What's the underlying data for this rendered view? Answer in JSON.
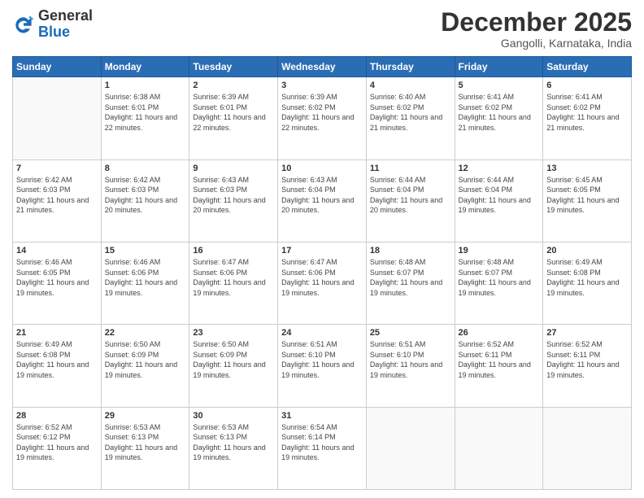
{
  "header": {
    "logo_general": "General",
    "logo_blue": "Blue",
    "month_title": "December 2025",
    "location": "Gangolli, Karnataka, India"
  },
  "weekdays": [
    "Sunday",
    "Monday",
    "Tuesday",
    "Wednesday",
    "Thursday",
    "Friday",
    "Saturday"
  ],
  "weeks": [
    [
      {
        "num": "",
        "sunrise": "",
        "sunset": "",
        "daylight": ""
      },
      {
        "num": "1",
        "sunrise": "6:38 AM",
        "sunset": "6:01 PM",
        "daylight": "11 hours and 22 minutes."
      },
      {
        "num": "2",
        "sunrise": "6:39 AM",
        "sunset": "6:01 PM",
        "daylight": "11 hours and 22 minutes."
      },
      {
        "num": "3",
        "sunrise": "6:39 AM",
        "sunset": "6:02 PM",
        "daylight": "11 hours and 22 minutes."
      },
      {
        "num": "4",
        "sunrise": "6:40 AM",
        "sunset": "6:02 PM",
        "daylight": "11 hours and 21 minutes."
      },
      {
        "num": "5",
        "sunrise": "6:41 AM",
        "sunset": "6:02 PM",
        "daylight": "11 hours and 21 minutes."
      },
      {
        "num": "6",
        "sunrise": "6:41 AM",
        "sunset": "6:02 PM",
        "daylight": "11 hours and 21 minutes."
      }
    ],
    [
      {
        "num": "7",
        "sunrise": "6:42 AM",
        "sunset": "6:03 PM",
        "daylight": "11 hours and 21 minutes."
      },
      {
        "num": "8",
        "sunrise": "6:42 AM",
        "sunset": "6:03 PM",
        "daylight": "11 hours and 20 minutes."
      },
      {
        "num": "9",
        "sunrise": "6:43 AM",
        "sunset": "6:03 PM",
        "daylight": "11 hours and 20 minutes."
      },
      {
        "num": "10",
        "sunrise": "6:43 AM",
        "sunset": "6:04 PM",
        "daylight": "11 hours and 20 minutes."
      },
      {
        "num": "11",
        "sunrise": "6:44 AM",
        "sunset": "6:04 PM",
        "daylight": "11 hours and 20 minutes."
      },
      {
        "num": "12",
        "sunrise": "6:44 AM",
        "sunset": "6:04 PM",
        "daylight": "11 hours and 19 minutes."
      },
      {
        "num": "13",
        "sunrise": "6:45 AM",
        "sunset": "6:05 PM",
        "daylight": "11 hours and 19 minutes."
      }
    ],
    [
      {
        "num": "14",
        "sunrise": "6:46 AM",
        "sunset": "6:05 PM",
        "daylight": "11 hours and 19 minutes."
      },
      {
        "num": "15",
        "sunrise": "6:46 AM",
        "sunset": "6:06 PM",
        "daylight": "11 hours and 19 minutes."
      },
      {
        "num": "16",
        "sunrise": "6:47 AM",
        "sunset": "6:06 PM",
        "daylight": "11 hours and 19 minutes."
      },
      {
        "num": "17",
        "sunrise": "6:47 AM",
        "sunset": "6:06 PM",
        "daylight": "11 hours and 19 minutes."
      },
      {
        "num": "18",
        "sunrise": "6:48 AM",
        "sunset": "6:07 PM",
        "daylight": "11 hours and 19 minutes."
      },
      {
        "num": "19",
        "sunrise": "6:48 AM",
        "sunset": "6:07 PM",
        "daylight": "11 hours and 19 minutes."
      },
      {
        "num": "20",
        "sunrise": "6:49 AM",
        "sunset": "6:08 PM",
        "daylight": "11 hours and 19 minutes."
      }
    ],
    [
      {
        "num": "21",
        "sunrise": "6:49 AM",
        "sunset": "6:08 PM",
        "daylight": "11 hours and 19 minutes."
      },
      {
        "num": "22",
        "sunrise": "6:50 AM",
        "sunset": "6:09 PM",
        "daylight": "11 hours and 19 minutes."
      },
      {
        "num": "23",
        "sunrise": "6:50 AM",
        "sunset": "6:09 PM",
        "daylight": "11 hours and 19 minutes."
      },
      {
        "num": "24",
        "sunrise": "6:51 AM",
        "sunset": "6:10 PM",
        "daylight": "11 hours and 19 minutes."
      },
      {
        "num": "25",
        "sunrise": "6:51 AM",
        "sunset": "6:10 PM",
        "daylight": "11 hours and 19 minutes."
      },
      {
        "num": "26",
        "sunrise": "6:52 AM",
        "sunset": "6:11 PM",
        "daylight": "11 hours and 19 minutes."
      },
      {
        "num": "27",
        "sunrise": "6:52 AM",
        "sunset": "6:11 PM",
        "daylight": "11 hours and 19 minutes."
      }
    ],
    [
      {
        "num": "28",
        "sunrise": "6:52 AM",
        "sunset": "6:12 PM",
        "daylight": "11 hours and 19 minutes."
      },
      {
        "num": "29",
        "sunrise": "6:53 AM",
        "sunset": "6:13 PM",
        "daylight": "11 hours and 19 minutes."
      },
      {
        "num": "30",
        "sunrise": "6:53 AM",
        "sunset": "6:13 PM",
        "daylight": "11 hours and 19 minutes."
      },
      {
        "num": "31",
        "sunrise": "6:54 AM",
        "sunset": "6:14 PM",
        "daylight": "11 hours and 19 minutes."
      },
      {
        "num": "",
        "sunrise": "",
        "sunset": "",
        "daylight": ""
      },
      {
        "num": "",
        "sunrise": "",
        "sunset": "",
        "daylight": ""
      },
      {
        "num": "",
        "sunrise": "",
        "sunset": "",
        "daylight": ""
      }
    ]
  ]
}
